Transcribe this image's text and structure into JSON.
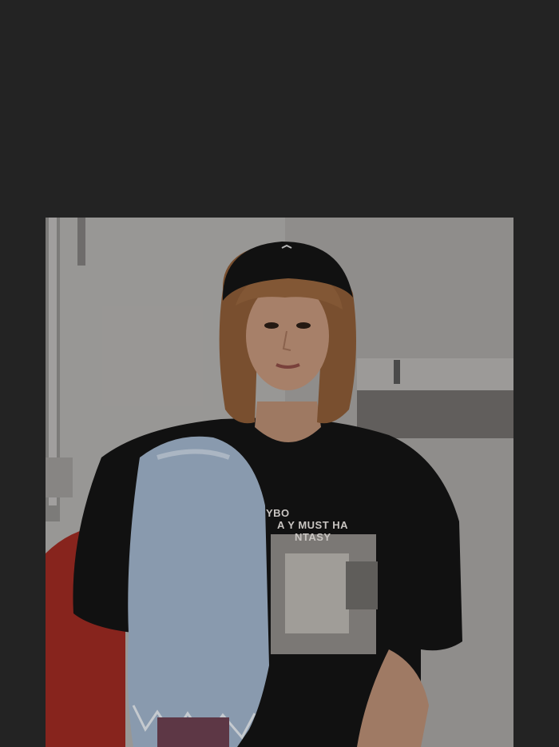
{
  "viewer": {
    "background_color": "#232323"
  },
  "photo": {
    "subject": "person",
    "shirt_lines": [
      "YBO",
      "A Y MUST HA",
      "NTASY"
    ],
    "colors": {
      "wall": "#a9a7a5",
      "shirt": "#121212",
      "jeans": "#9fb2c8",
      "chair": "#9c2b22",
      "hat": "#151515",
      "hair": "#8a5a34",
      "skin": "#b88c72"
    }
  }
}
